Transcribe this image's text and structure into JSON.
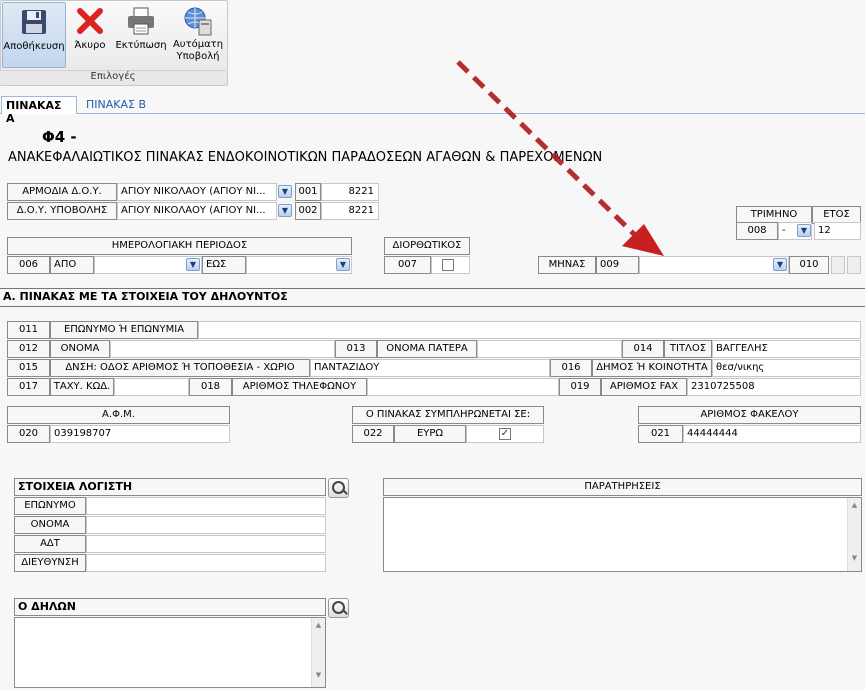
{
  "ribbon": {
    "buttons": [
      {
        "label": "Αποθήκευση",
        "icon": "save-icon"
      },
      {
        "label": "Άκυρο",
        "icon": "cancel-icon"
      },
      {
        "label": "Εκτύπωση",
        "icon": "printer-icon"
      },
      {
        "label": "Αυτόματη Υποβολή",
        "icon": "globe-submit-icon"
      }
    ],
    "group_label": "Επιλογές"
  },
  "tabs": [
    {
      "label": "ΠΙΝΑΚΑΣ Α",
      "active": true
    },
    {
      "label": "ΠΙΝΑΚΑΣ Β",
      "active": false
    }
  ],
  "header": {
    "form_code": "Φ4 -",
    "form_title": "ΑΝΑΚΕΦΑΛΑΙΩΤΙΚΟΣ ΠΙΝΑΚΑΣ ΕΝΔΟΚΟΙΝΟΤΙΚΩΝ ΠΑΡΑΔΟΣΕΩΝ ΑΓΑΘΩΝ & ΠΑΡΕΧΟΜΕΝΩΝ"
  },
  "doy": {
    "armodia_label": "ΑΡΜΟΔΙΑ Δ.Ο.Υ.",
    "armodia_value": "ΑΓΙΟΥ ΝΙΚΟΛΑΟΥ (ΑΓΙΟΥ ΝΙ...",
    "armodia_code": "001",
    "armodia_num": "8221",
    "ypovolis_label": "Δ.Ο.Υ. ΥΠΟΒΟΛΗΣ",
    "ypovolis_value": "ΑΓΙΟΥ ΝΙΚΟΛΑΟΥ (ΑΓΙΟΥ ΝΙ...",
    "ypovolis_code": "002",
    "ypovolis_num": "8221"
  },
  "period": {
    "title": "ΗΜΕΡΟΛΟΓΙΑΚΗ ΠΕΡΙΟΔΟΣ",
    "code": "006",
    "from_label": "ΑΠΟ",
    "to_label": "ΕΩΣ",
    "from_value": "",
    "to_value": ""
  },
  "corrective": {
    "title": "ΔΙΟΡΘΩΤΙΚΟΣ",
    "code": "007",
    "checked": false
  },
  "quarter": {
    "title": "ΤΡΙΜΗΝΟ",
    "code": "008",
    "value": "-",
    "year_title": "ΕΤΟΣ",
    "year_value": "12"
  },
  "month": {
    "label": "ΜΗΝΑΣ",
    "code": "009",
    "value": "",
    "code2": "010"
  },
  "sectionA": {
    "title": "Α. ΠΙΝΑΚΑΣ ΜΕ ΤΑ ΣΤΟΙΧΕΙΑ ΤΟΥ ΔΗΛΟΥΝΤΟΣ",
    "f011": {
      "code": "011",
      "label": "ΕΠΩΝΥΜΟ Ή ΕΠΩΝΥΜΙΑ",
      "value": ""
    },
    "f012": {
      "code": "012",
      "label": "ΟΝΟΜΑ",
      "value": ""
    },
    "f013": {
      "code": "013",
      "label": "ΟΝΟΜΑ ΠΑΤΕΡΑ",
      "value": ""
    },
    "f014": {
      "code": "014",
      "label": "ΤΙΤΛΟΣ",
      "value": "ΒΑΓΓΕΛΗΣ"
    },
    "f015": {
      "code": "015",
      "label": "ΔΝΣΗ: ΟΔΟΣ ΑΡΙΘΜΟΣ Ή ΤΟΠΟΘΕΣΙΑ - ΧΩΡΙΟ",
      "value": "ΠΑΝΤΑΖΙΔΟΥ"
    },
    "f016": {
      "code": "016",
      "label": "ΔΗΜΟΣ Ή ΚΟΙΝΟΤΗΤΑ",
      "value": "θεσ/νικης"
    },
    "f017": {
      "code": "017",
      "label": "ΤΑΧΥ. ΚΩΔ.",
      "value": ""
    },
    "f018": {
      "code": "018",
      "label": "ΑΡΙΘΜΟΣ ΤΗΛΕΦΩΝΟΥ",
      "value": ""
    },
    "f019": {
      "code": "019",
      "label": "ΑΡΙΘΜΟΣ FAX",
      "value": "2310725508"
    },
    "afm": {
      "title": "Α.Φ.Μ.",
      "code": "020",
      "value": "039198707"
    },
    "currency": {
      "title": "Ο ΠΙΝΑΚΑΣ ΣΥΜΠΛΗΡΩΝΕΤΑΙ ΣΕ:",
      "code": "022",
      "label": "ΕΥΡΩ",
      "checked": true
    },
    "folder": {
      "title": "ΑΡΙΘΜΟΣ ΦΑΚΕΛΟΥ",
      "code": "021",
      "value": "44444444"
    }
  },
  "accountant": {
    "title": "ΣΤΟΙΧΕΙΑ ΛΟΓΙΣΤΗ",
    "rows": [
      {
        "label": "ΕΠΩΝΥΜΟ",
        "value": ""
      },
      {
        "label": "ΟΝΟΜΑ",
        "value": ""
      },
      {
        "label": "ΑΔΤ",
        "value": ""
      },
      {
        "label": "ΔΙΕΥΘΥΝΣΗ",
        "value": ""
      }
    ]
  },
  "remarks": {
    "title": "ΠΑΡΑΤΗΡΗΣΕΙΣ",
    "value": ""
  },
  "declarant": {
    "title": "Ο ΔΗΛΩΝ",
    "value": ""
  },
  "colors": {
    "arrow": "#c62020",
    "tab_blue": "#1f5fb0",
    "border": "#8a8a8a"
  }
}
